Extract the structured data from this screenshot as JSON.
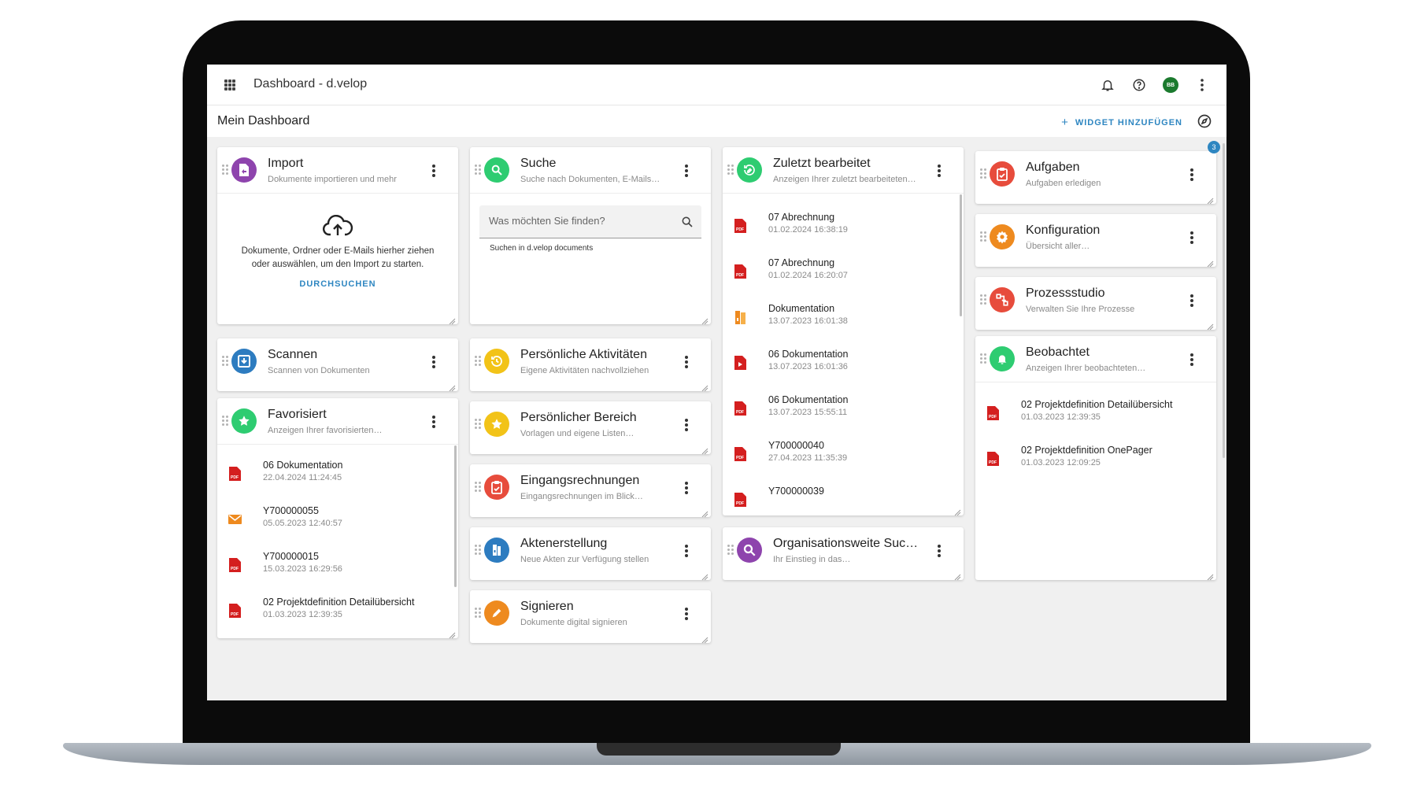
{
  "header": {
    "app_title": "Dashboard - d.velop",
    "avatar_initials": "BB"
  },
  "subheader": {
    "page_title": "Mein Dashboard",
    "add_widget": "WIDGET HINZUFÜGEN"
  },
  "colors": {
    "accent": "#2e86c1",
    "purple": "#8e44ad",
    "green": "#2ecc71",
    "blue": "#2d7cc0",
    "yellow": "#f2c318",
    "red": "#e74c3c",
    "orange": "#ee8a1f",
    "pdf_red": "#d41f1f"
  },
  "import": {
    "title": "Import",
    "subtitle": "Dokumente importieren und mehr",
    "text1": "Dokumente, Ordner oder E-Mails hierher ziehen",
    "text2": "oder auswählen, um den Import zu starten.",
    "browse": "DURCHSUCHEN"
  },
  "scannen": {
    "title": "Scannen",
    "subtitle": "Scannen von Dokumenten"
  },
  "favorisiert": {
    "title": "Favorisiert",
    "subtitle": "Anzeigen Ihrer favorisierten…",
    "items": [
      {
        "name": "06 Dokumentation",
        "date": "22.04.2024 11:24:45",
        "icon": "pdf-icon"
      },
      {
        "name": "Y700000055",
        "date": "05.05.2023 12:40:57",
        "icon": "mail-icon"
      },
      {
        "name": "Y700000015",
        "date": "15.03.2023 16:29:56",
        "icon": "pdf-icon"
      },
      {
        "name": "02 Projektdefinition Detailübersicht",
        "date": "01.03.2023 12:39:35",
        "icon": "pdf-icon"
      }
    ]
  },
  "suche": {
    "title": "Suche",
    "subtitle": "Suche nach Dokumenten, E-Mails…",
    "placeholder": "Was möchten Sie finden?",
    "hint": "Suchen in d.velop documents"
  },
  "aktivitaeten": {
    "title": "Persönliche Aktivitäten",
    "subtitle": "Eigene Aktivitäten nachvollziehen"
  },
  "bereich": {
    "title": "Persönlicher Bereich",
    "subtitle": "Vorlagen und eigene Listen…"
  },
  "rechnungen": {
    "title": "Eingangsrechnungen",
    "subtitle": "Eingangsrechnungen im Blick…"
  },
  "akten": {
    "title": "Aktenerstellung",
    "subtitle": "Neue Akten zur Verfügung stellen"
  },
  "signieren": {
    "title": "Signieren",
    "subtitle": "Dokumente digital signieren"
  },
  "zuletzt": {
    "title": "Zuletzt bearbeitet",
    "subtitle": "Anzeigen Ihrer zuletzt bearbeiteten…",
    "items": [
      {
        "name": "07 Abrechnung",
        "date": "01.02.2024 16:38:19",
        "icon": "pdf-icon"
      },
      {
        "name": "07 Abrechnung",
        "date": "01.02.2024 16:20:07",
        "icon": "pdf-icon"
      },
      {
        "name": "Dokumentation",
        "date": "13.07.2023 16:01:38",
        "icon": "binder-icon"
      },
      {
        "name": "06 Dokumentation",
        "date": "13.07.2023 16:01:36",
        "icon": "document-icon"
      },
      {
        "name": "06 Dokumentation",
        "date": "13.07.2023 15:55:11",
        "icon": "pdf-icon"
      },
      {
        "name": "Y700000040",
        "date": "27.04.2023 11:35:39",
        "icon": "pdf-icon"
      },
      {
        "name": "Y700000039",
        "date": "",
        "icon": "pdf-icon"
      }
    ]
  },
  "orgsuche": {
    "title": "Organisationsweite Suc…",
    "subtitle": "Ihr Einstieg in das…"
  },
  "aufgaben": {
    "title": "Aufgaben",
    "subtitle": "Aufgaben erledigen",
    "badge": "3"
  },
  "konfiguration": {
    "title": "Konfiguration",
    "subtitle": "Übersicht aller…"
  },
  "prozessstudio": {
    "title": "Prozessstudio",
    "subtitle": "Verwalten Sie Ihre Prozesse"
  },
  "beobachtet": {
    "title": "Beobachtet",
    "subtitle": "Anzeigen Ihrer beobachteten…",
    "items": [
      {
        "name": "02 Projektdefinition Detailübersicht",
        "date": "01.03.2023 12:39:35",
        "icon": "pdf-icon"
      },
      {
        "name": "02 Projektdefinition OnePager",
        "date": "01.03.2023 12:09:25",
        "icon": "pdf-icon"
      }
    ]
  }
}
